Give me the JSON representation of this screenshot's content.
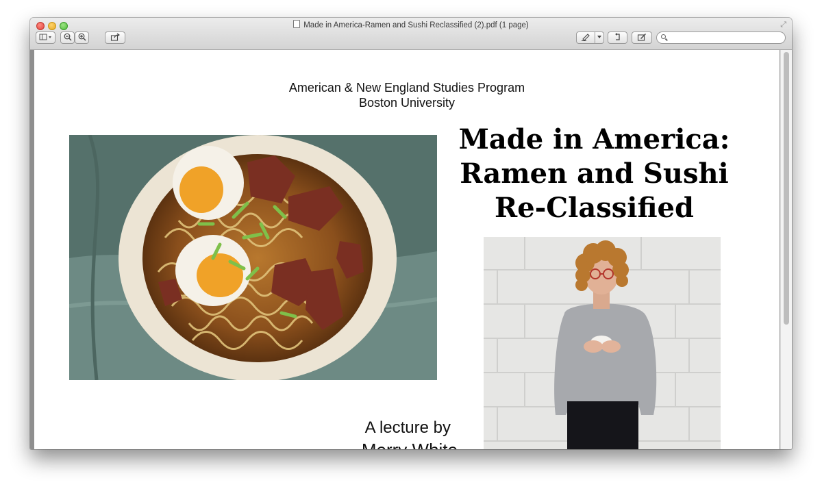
{
  "window": {
    "title": "Made in America-Ramen and Sushi Reclassified (2).pdf (1 page)"
  },
  "toolbar": {
    "sidebar_icon": "sidebar-toggle-icon",
    "zoom_out_icon": "zoom-out-icon",
    "zoom_in_icon": "zoom-in-icon",
    "share_icon": "share-icon",
    "annotate_icon": "highlighter-icon",
    "rotate_icon": "rotate-icon",
    "markup_icon": "edit-toolbar-icon",
    "search_placeholder": ""
  },
  "document": {
    "program_line1": "American & New England Studies Program",
    "program_line2": "Boston University",
    "headline_line1": "Made in America:",
    "headline_line2": "Ramen and Sushi",
    "headline_line3": "Re-Classified",
    "lecture_by": "A lecture by",
    "speaker_partial": "Merry White"
  },
  "colors": {
    "page_bg": "#ffffff",
    "viewport_bg": "#8f8f8f",
    "close": "#e0443e",
    "minimize": "#e5a823",
    "zoom": "#4fbd3a"
  }
}
